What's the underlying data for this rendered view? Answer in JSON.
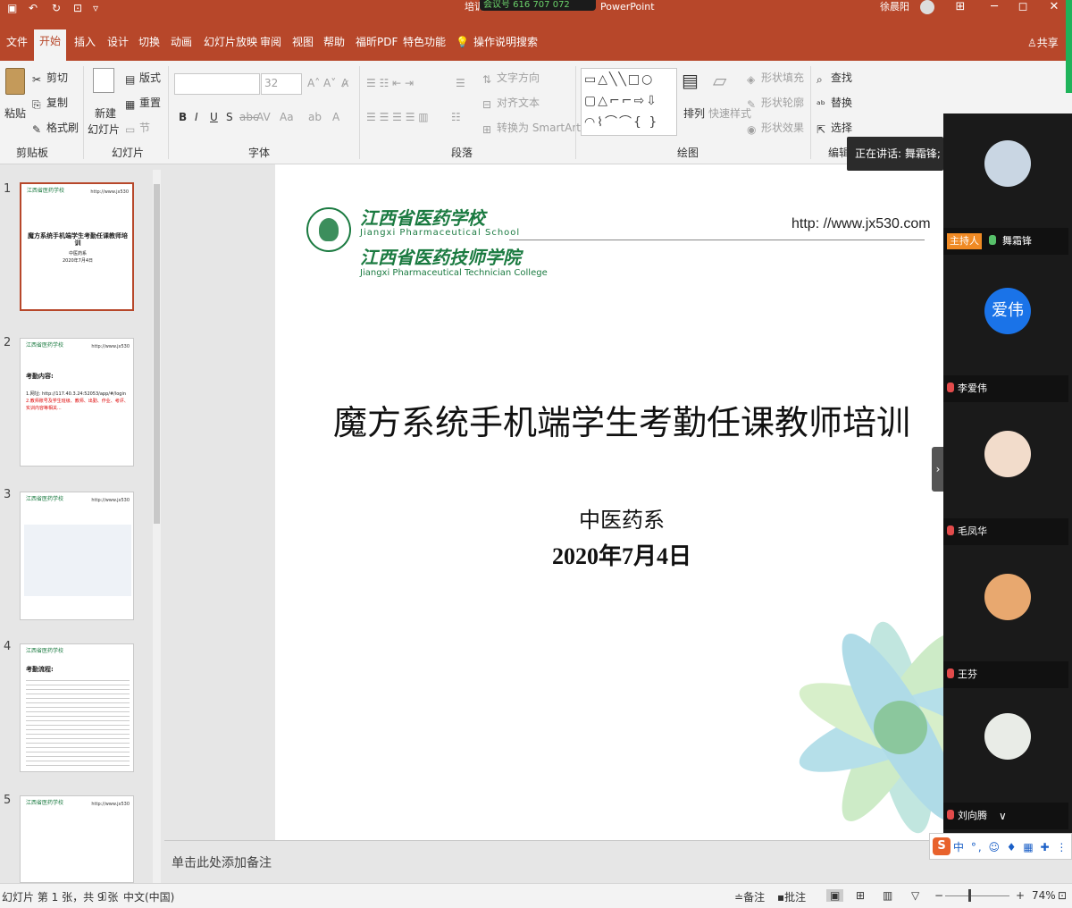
{
  "titlebar": {
    "window_title": "培训",
    "meeting_pill": "会议号 616 707 072",
    "app_suffix": "PowerPoint",
    "user": "徐晨阳",
    "min": "─",
    "max": "◻",
    "close": "✕",
    "save_icon": "save-icon",
    "undo_icon": "undo-icon",
    "redo_icon": "redo-icon"
  },
  "tabs": [
    "文件",
    "开始",
    "插入",
    "设计",
    "切换",
    "动画",
    "幻灯片放映",
    "审阅",
    "视图",
    "帮助",
    "福昕PDF",
    "特色功能",
    "操作说明搜索"
  ],
  "share_label": "共享",
  "ribbon": {
    "clipboard": {
      "paste": "粘贴",
      "cut": "剪切",
      "copy": "复制",
      "format_painter": "格式刷",
      "group": "剪贴板"
    },
    "slides": {
      "new_slide": "新建",
      "new_slide2": "幻灯片",
      "layout": "版式",
      "reset": "重置",
      "section": "节",
      "group": "幻灯片"
    },
    "font": {
      "size": "32",
      "bold": "B",
      "italic": "I",
      "underline": "U",
      "strike": "S",
      "shadow": "abc",
      "spacing": "AV",
      "case": "Aa",
      "group": "字体"
    },
    "paragraph": {
      "text_direction": "文字方向",
      "align_text": "对齐文本",
      "smartart": "转换为 SmartArt",
      "group": "段落"
    },
    "drawing": {
      "arrange": "排列",
      "quick_styles": "快速样式",
      "shape_fill": "形状填充",
      "shape_outline": "形状轮廓",
      "shape_effects": "形状效果",
      "group": "绘图"
    },
    "editing": {
      "find": "查找",
      "replace": "替换",
      "select": "选择",
      "group": "编辑"
    }
  },
  "thumbnails": [
    {
      "num": "1",
      "title": "魔方系统手机端学生考勤任课教师培训",
      "sub": "中医药系",
      "date": "2020年7月4日"
    },
    {
      "num": "2",
      "title": "考勤内容:",
      "line1": "1.网址: http://117.40.3.24:52053/app/#/login",
      "line2": "2.教师账号及学生班级、教师、出勤、作业、考评、实训内容等相关..."
    },
    {
      "num": "3"
    },
    {
      "num": "4",
      "title": "考勤流程:"
    },
    {
      "num": "5"
    }
  ],
  "thumb_logo": "江西省医药学校",
  "thumb_url": "http://www.jx530",
  "slide": {
    "school_cn": "江西省医药学校",
    "school_en": "Jiangxi Pharmaceutical School",
    "college_cn": "江西省医药技师学院",
    "college_en": "Jiangxi Pharmaceutical Technician College",
    "url": "http: //www.jx530.com",
    "title": "魔方系统手机端学生考勤任课教师培训",
    "dept": "中医药系",
    "date": "2020年7月4日"
  },
  "notes_placeholder": "单击此处添加备注",
  "status": {
    "slide_info": "幻灯片 第 1 张，共 9 张",
    "language": "中文(中国)",
    "notes": "备注",
    "comments": "批注",
    "zoom": "74%",
    "minus": "−",
    "plus": "+"
  },
  "meeting": {
    "speaking": "正在讲话: 舞霜锋;",
    "participants": [
      {
        "name": "舞霜锋",
        "badge": "主持人"
      },
      {
        "name": "李爱伟",
        "avatar_text": "爱伟"
      },
      {
        "name": "毛凤华"
      },
      {
        "name": "王芬"
      },
      {
        "name": "刘向腾"
      }
    ]
  },
  "ime": {
    "s": "S",
    "rest": "中 °, ☺ ♦ ▦ ✚ ⋮"
  }
}
